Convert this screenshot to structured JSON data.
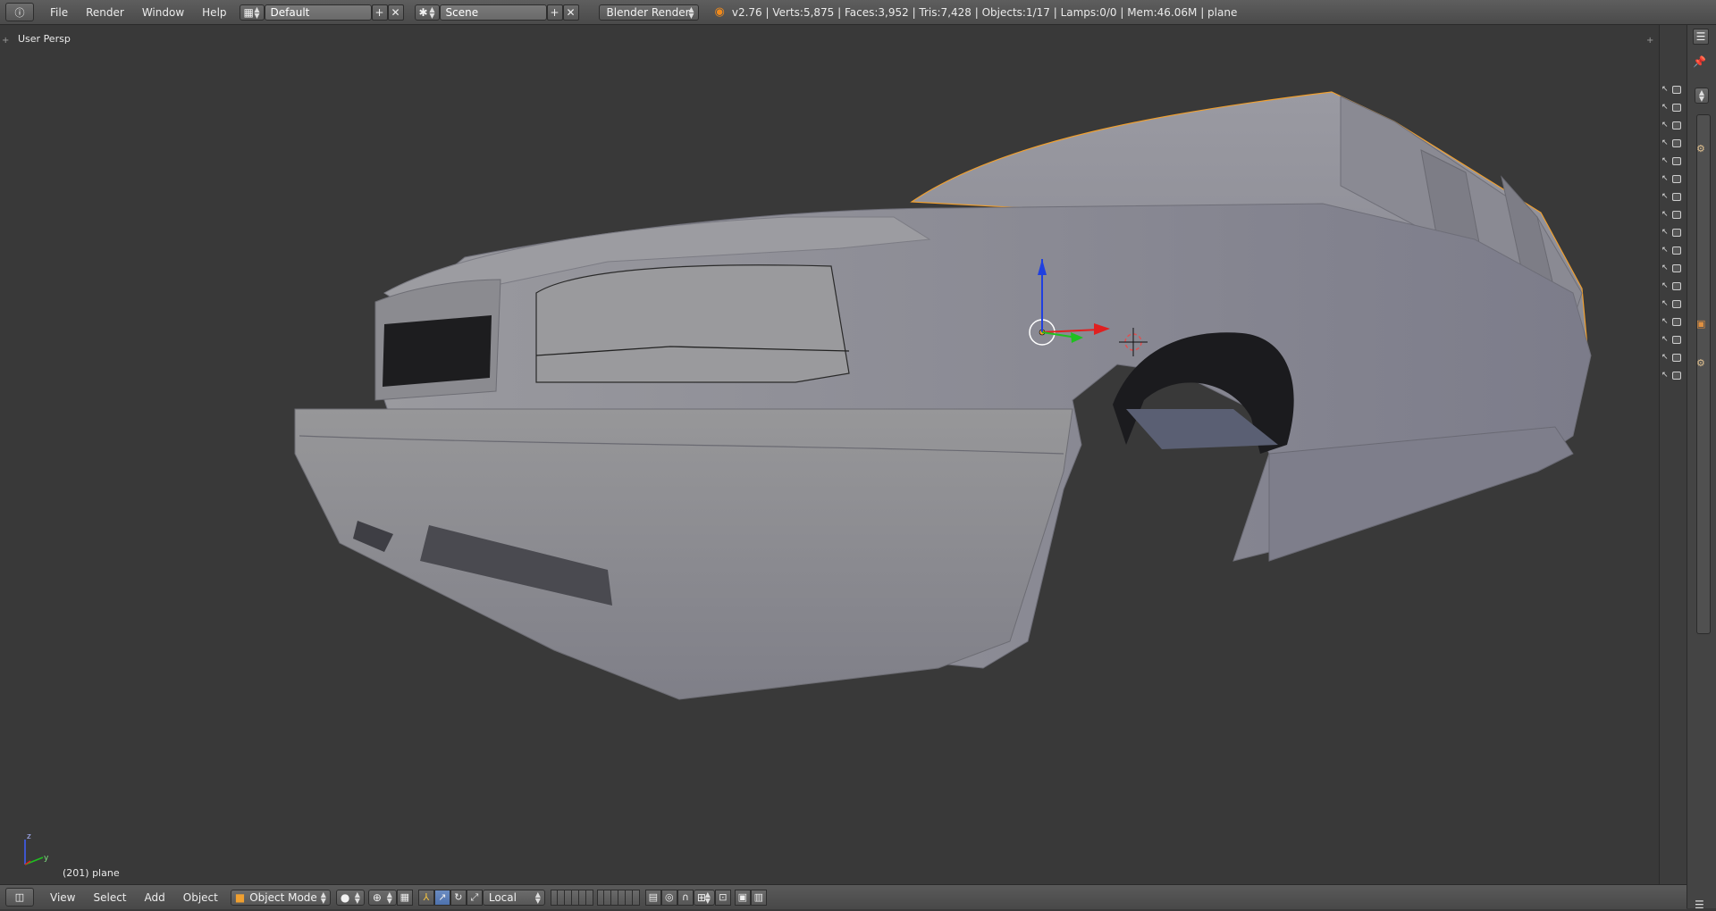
{
  "top_bar": {
    "menus": [
      "File",
      "Render",
      "Window",
      "Help"
    ],
    "screen_layout": "Default",
    "scene": "Scene",
    "render_engine": "Blender Render",
    "stats": "v2.76 | Verts:5,875 | Faces:3,952 | Tris:7,428 | Objects:1/17 | Lamps:0/0 | Mem:46.06M | plane"
  },
  "viewport": {
    "view_name": "User Persp",
    "object_info": "(201) plane",
    "axis_labels": {
      "x": "y",
      "z": "z"
    }
  },
  "bottom_bar": {
    "menus": [
      "View",
      "Select",
      "Add",
      "Object"
    ],
    "mode": "Object Mode",
    "transform_orientation": "Local"
  },
  "colors": {
    "background": "#393939",
    "header": "#4a4a4a",
    "selection_outline": "#f0a030",
    "mesh": "#8e8e98",
    "axis_x": "#e02020",
    "axis_y": "#20c020",
    "axis_z": "#2040e0"
  },
  "outliner_rows": 17
}
